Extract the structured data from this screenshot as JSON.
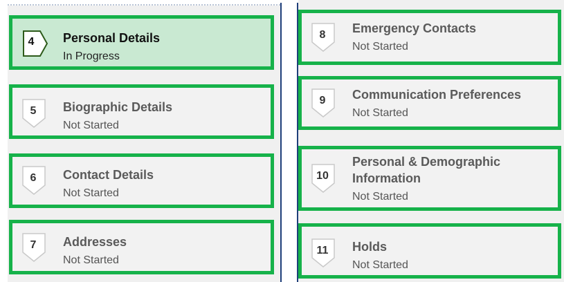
{
  "left_steps": [
    {
      "number": "4",
      "title": "Personal Details",
      "status": "In Progress",
      "active": true
    },
    {
      "number": "5",
      "title": "Biographic Details",
      "status": "Not Started",
      "active": false
    },
    {
      "number": "6",
      "title": "Contact Details",
      "status": "Not Started",
      "active": false
    },
    {
      "number": "7",
      "title": "Addresses",
      "status": "Not Started",
      "active": false
    }
  ],
  "right_steps": [
    {
      "number": "8",
      "title": "Emergency Contacts",
      "status": "Not Started",
      "active": false
    },
    {
      "number": "9",
      "title": "Communication Preferences",
      "status": "Not Started",
      "active": false
    },
    {
      "number": "10",
      "title_line1": "Personal & Demographic",
      "title_line2": "Information",
      "status": "Not Started",
      "active": false
    },
    {
      "number": "11",
      "title": "Holds",
      "status": "Not Started",
      "active": false
    }
  ],
  "colors": {
    "highlight_border": "#16b24a",
    "active_bg": "#c9e9d2",
    "column_border": "#1f3f7a"
  }
}
